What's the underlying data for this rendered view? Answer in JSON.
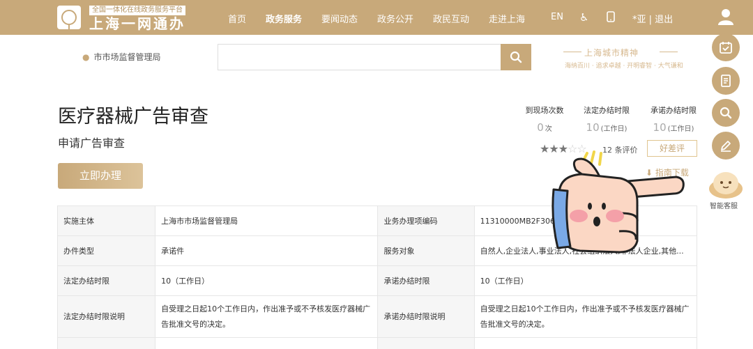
{
  "header": {
    "brand_sub": "全国一体化在线政务服务平台",
    "brand_title": "上海一网通办",
    "nav": [
      "首页",
      "政务服务",
      "要闻动态",
      "政务公开",
      "政民互动",
      "走进上海"
    ],
    "active_nav": "政务服务",
    "lang": "EN",
    "user": "*亚 | 退出",
    "accent_color": "#c8a97a"
  },
  "search": {
    "location": "市市场监督管理局",
    "placeholder": ""
  },
  "slogan": {
    "title": "上海城市精神",
    "sub": "海纳百川 · 追求卓越 · 开明睿智 · 大气谦和"
  },
  "service": {
    "title": "医疗器械广告审查",
    "subtitle": "申请广告审查",
    "apply_label": "立即办理"
  },
  "stats": [
    {
      "label": "到现场次数",
      "value": "0",
      "unit": "次"
    },
    {
      "label": "法定办结时限",
      "value": "10",
      "unit": "(工作日)"
    },
    {
      "label": "承诺办结时限",
      "value": "10",
      "unit": "(工作日)"
    }
  ],
  "rating": {
    "stars": 3,
    "max_stars": 5,
    "reviews": "12 条评价",
    "review_btn": "好差评",
    "guide": "指南下载"
  },
  "float_bar": {
    "icons": [
      "calendar-check-icon",
      "document-edit-icon",
      "search-icon",
      "pen-icon"
    ],
    "assistant_label": "智能客服"
  },
  "table": {
    "rows": [
      {
        "k1": "实施主体",
        "v1": "上海市市场监督管理局",
        "k2": "业务办理项编码",
        "v2": "11310000MB2F306"
      },
      {
        "k1": "办件类型",
        "v1": "承诺件",
        "k2": "服务对象",
        "v2": "自然人,企业法人,事业法人,社会组织法人,非法人企业,其他..."
      },
      {
        "k1": "法定办结时限",
        "v1": "10（工作日）",
        "k2": "承诺办结时限",
        "v2": "10（工作日）"
      },
      {
        "k1": "法定办结时限说明",
        "v1": "自受理之日起10个工作日内，作出准予或不予核发医疗器械广告批准文号的决定。",
        "k2": "承诺办结时限说明",
        "v2": "自受理之日起10个工作日内，作出准予或不予核发医疗器械广告批准文号的决定。"
      }
    ]
  }
}
